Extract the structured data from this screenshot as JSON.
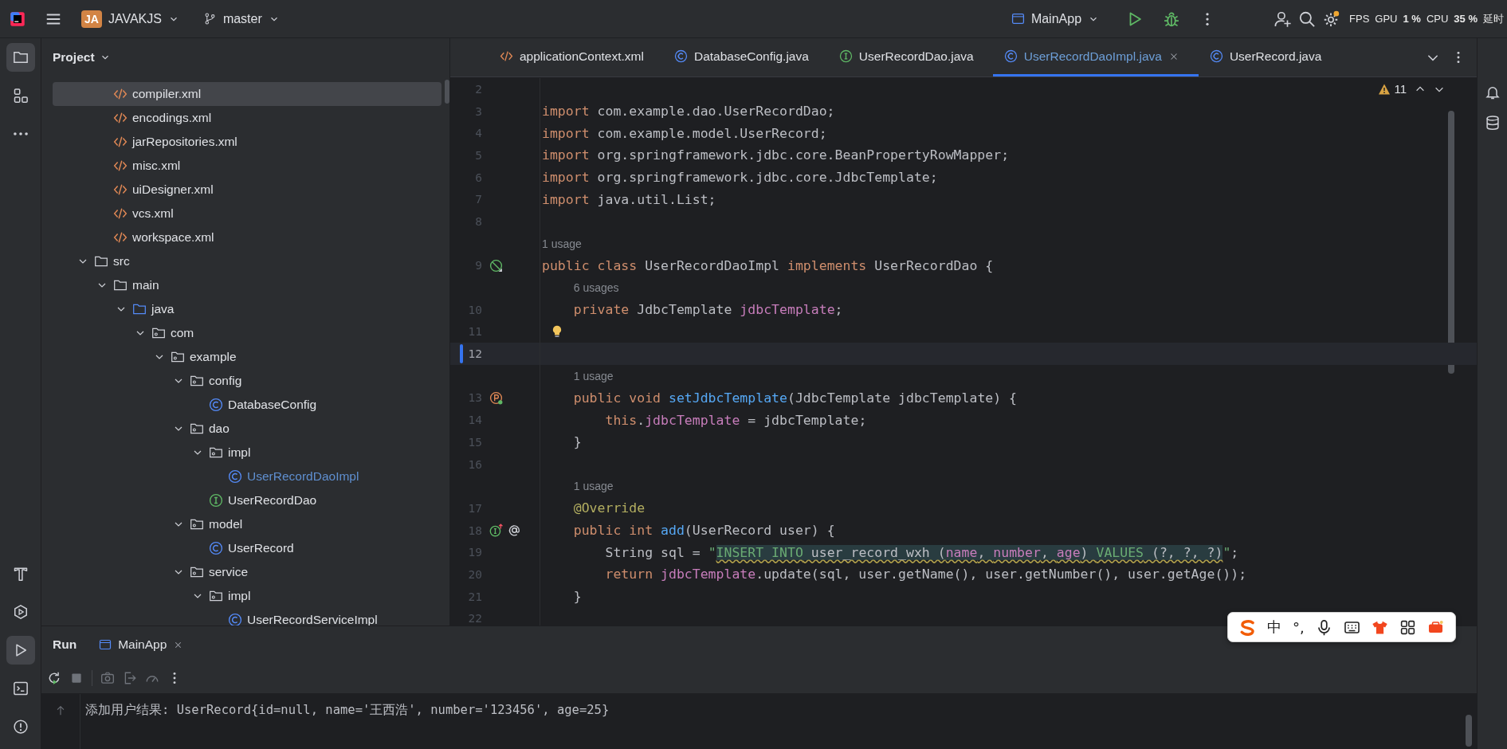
{
  "title_bar": {
    "project_badge": "JA",
    "project_name": "JAVAKJS",
    "branch": "master",
    "run_config": "MainApp",
    "system_overlay": [
      "FPS",
      "GPU",
      "1 %",
      "CPU",
      "35 %",
      "延时"
    ]
  },
  "tool_strip": {
    "top": [
      {
        "kind": "project",
        "selected": true
      },
      {
        "kind": "structure",
        "selected": false
      },
      {
        "kind": "more",
        "selected": false
      }
    ],
    "bottom": [
      {
        "kind": "build",
        "selected": false
      },
      {
        "kind": "services",
        "selected": false
      },
      {
        "kind": "run",
        "selected": true
      },
      {
        "kind": "terminal",
        "selected": false
      },
      {
        "kind": "problems",
        "selected": false
      }
    ]
  },
  "project_panel": {
    "title": "Project",
    "scrolled_children": [
      {
        "label": "compiler.xml",
        "kind": "xml",
        "selected": true,
        "current": false
      },
      {
        "label": "encodings.xml",
        "kind": "xml",
        "selected": false,
        "current": false
      },
      {
        "label": "jarRepositories.xml",
        "kind": "xml",
        "selected": false,
        "current": false
      },
      {
        "label": "misc.xml",
        "kind": "xml",
        "selected": false,
        "current": false
      },
      {
        "label": "uiDesigner.xml",
        "kind": "xml",
        "selected": false,
        "current": false
      },
      {
        "label": "vcs.xml",
        "kind": "xml",
        "selected": false,
        "current": false
      },
      {
        "label": "workspace.xml",
        "kind": "xml",
        "selected": false,
        "current": false
      }
    ],
    "tree": [
      {
        "label": "src",
        "kind": "folder",
        "expanded": true,
        "selected": false,
        "current": false,
        "children": [
          {
            "label": "main",
            "kind": "folder",
            "expanded": true,
            "selected": false,
            "current": false,
            "children": [
              {
                "label": "java",
                "kind": "source",
                "expanded": true,
                "selected": false,
                "current": false,
                "children": [
                  {
                    "label": "com",
                    "kind": "package",
                    "expanded": true,
                    "selected": false,
                    "current": false,
                    "children": [
                      {
                        "label": "example",
                        "kind": "package",
                        "expanded": true,
                        "selected": false,
                        "current": false,
                        "children": [
                          {
                            "label": "config",
                            "kind": "package",
                            "expanded": true,
                            "selected": false,
                            "current": false,
                            "children": [
                              {
                                "label": "DatabaseConfig",
                                "kind": "class",
                                "selected": false,
                                "current": false
                              }
                            ]
                          },
                          {
                            "label": "dao",
                            "kind": "package",
                            "expanded": true,
                            "selected": false,
                            "current": false,
                            "children": [
                              {
                                "label": "impl",
                                "kind": "package",
                                "expanded": true,
                                "selected": false,
                                "current": false,
                                "children": [
                                  {
                                    "label": "UserRecordDaoImpl",
                                    "kind": "class",
                                    "selected": false,
                                    "current": true
                                  }
                                ]
                              },
                              {
                                "label": "UserRecordDao",
                                "kind": "interface",
                                "selected": false,
                                "current": false
                              }
                            ]
                          },
                          {
                            "label": "model",
                            "kind": "package",
                            "expanded": true,
                            "selected": false,
                            "current": false,
                            "children": [
                              {
                                "label": "UserRecord",
                                "kind": "class",
                                "selected": false,
                                "current": false
                              }
                            ]
                          },
                          {
                            "label": "service",
                            "kind": "package",
                            "expanded": true,
                            "selected": false,
                            "current": false,
                            "children": [
                              {
                                "label": "impl",
                                "kind": "package",
                                "expanded": true,
                                "selected": false,
                                "current": false,
                                "children": [
                                  {
                                    "label": "UserRecordServiceImpl",
                                    "kind": "class",
                                    "selected": false,
                                    "current": false
                                  }
                                ]
                              }
                            ]
                          }
                        ]
                      }
                    ]
                  }
                ]
              }
            ]
          }
        ]
      }
    ]
  },
  "editor": {
    "tabs": [
      {
        "label": "applicationContext.xml",
        "kind": "xml",
        "selected": false
      },
      {
        "label": "DatabaseConfig.java",
        "kind": "class",
        "selected": false
      },
      {
        "label": "UserRecordDao.java",
        "kind": "interface",
        "selected": false
      },
      {
        "label": "UserRecordDaoImpl.java",
        "kind": "class",
        "selected": true
      },
      {
        "label": "UserRecord.java",
        "kind": "class",
        "selected": false
      }
    ],
    "warning_count": "11",
    "lines": [
      {
        "kind": "code",
        "number": "2",
        "current": false
      },
      {
        "kind": "code",
        "number": "3",
        "current": false,
        "tokens": [
          {
            "kind": "keyword",
            "text": "import"
          },
          {
            "kind": "plain",
            "text": " com.example.dao.UserRecordDao;"
          }
        ]
      },
      {
        "kind": "code",
        "number": "4",
        "current": false,
        "tokens": [
          {
            "kind": "keyword",
            "text": "import"
          },
          {
            "kind": "plain",
            "text": " com.example.model.UserRecord;"
          }
        ]
      },
      {
        "kind": "code",
        "number": "5",
        "current": false,
        "tokens": [
          {
            "kind": "keyword",
            "text": "import"
          },
          {
            "kind": "plain",
            "text": " org.springframework.jdbc.core.BeanPropertyRowMapper;"
          }
        ]
      },
      {
        "kind": "code",
        "number": "6",
        "current": false,
        "tokens": [
          {
            "kind": "keyword",
            "text": "import"
          },
          {
            "kind": "plain",
            "text": " org.springframework.jdbc.core.JdbcTemplate;"
          }
        ]
      },
      {
        "kind": "code",
        "number": "7",
        "current": false,
        "tokens": [
          {
            "kind": "keyword",
            "text": "import"
          },
          {
            "kind": "plain",
            "text": " java.util.List;"
          }
        ]
      },
      {
        "kind": "code",
        "number": "8",
        "current": false
      },
      {
        "kind": "hint",
        "text": "1 usage"
      },
      {
        "kind": "code",
        "number": "9",
        "current": false,
        "gutter": [
          {
            "kind": "implemented"
          }
        ],
        "tokens": [
          {
            "kind": "keyword",
            "text": "public class"
          },
          {
            "kind": "plain",
            "text": " UserRecordDaoImpl "
          },
          {
            "kind": "keyword",
            "text": "implements"
          },
          {
            "kind": "plain",
            "text": " UserRecordDao {"
          }
        ]
      },
      {
        "kind": "hint",
        "text": "6 usages"
      },
      {
        "kind": "code",
        "number": "10",
        "current": false,
        "tokens": [
          {
            "kind": "keyword",
            "text": "    private"
          },
          {
            "kind": "plain",
            "text": " JdbcTemplate "
          },
          {
            "kind": "field",
            "text": "jdbcTemplate"
          },
          {
            "kind": "plain",
            "text": ";"
          }
        ]
      },
      {
        "kind": "code",
        "number": "11",
        "current": false,
        "bulb": true
      },
      {
        "kind": "code",
        "number": "12",
        "current": true
      },
      {
        "kind": "hint",
        "text": "1 usage"
      },
      {
        "kind": "code",
        "number": "13",
        "current": false,
        "gutter": [
          {
            "kind": "property"
          }
        ],
        "tokens": [
          {
            "kind": "keyword",
            "text": "    public void "
          },
          {
            "kind": "method",
            "text": "setJdbcTemplate"
          },
          {
            "kind": "plain",
            "text": "(JdbcTemplate jdbcTemplate) {"
          }
        ]
      },
      {
        "kind": "code",
        "number": "14",
        "current": false,
        "tokens": [
          {
            "kind": "keyword",
            "text": "        this"
          },
          {
            "kind": "plain",
            "text": "."
          },
          {
            "kind": "field",
            "text": "jdbcTemplate"
          },
          {
            "kind": "plain",
            "text": " = jdbcTemplate;"
          }
        ]
      },
      {
        "kind": "code",
        "number": "15",
        "current": false,
        "tokens": [
          {
            "kind": "plain",
            "text": "    }"
          }
        ]
      },
      {
        "kind": "code",
        "number": "16",
        "current": false
      },
      {
        "kind": "hint",
        "text": "1 usage"
      },
      {
        "kind": "code",
        "number": "17",
        "current": false,
        "tokens": [
          {
            "kind": "annotation",
            "text": "    @Override"
          }
        ]
      },
      {
        "kind": "code",
        "number": "18",
        "current": false,
        "gutter": [
          {
            "kind": "implements"
          },
          {
            "kind": "annotation"
          }
        ],
        "tokens": [
          {
            "kind": "keyword",
            "text": "    public int "
          },
          {
            "kind": "method",
            "text": "add"
          },
          {
            "kind": "plain",
            "text": "(UserRecord user) {"
          }
        ]
      },
      {
        "kind": "code",
        "number": "19",
        "current": false,
        "tokens": [
          {
            "kind": "plain",
            "text": "        String sql = "
          },
          {
            "kind": "string",
            "text": "\""
          },
          {
            "kind": "sql-keyword",
            "text": "INSERT INTO"
          },
          {
            "kind": "sql",
            "text": " user_record_wxh ("
          },
          {
            "kind": "sql-column",
            "text": "name"
          },
          {
            "kind": "sql",
            "text": ", "
          },
          {
            "kind": "sql-column",
            "text": "number"
          },
          {
            "kind": "sql",
            "text": ", "
          },
          {
            "kind": "sql-column",
            "text": "age"
          },
          {
            "kind": "sql",
            "text": ") "
          },
          {
            "kind": "sql-keyword",
            "text": "VALUES"
          },
          {
            "kind": "sql",
            "text": " (?, ?, ?)"
          },
          {
            "kind": "string",
            "text": "\""
          },
          {
            "kind": "plain",
            "text": ";"
          }
        ]
      },
      {
        "kind": "code",
        "number": "20",
        "current": false,
        "tokens": [
          {
            "kind": "keyword",
            "text": "        return "
          },
          {
            "kind": "field",
            "text": "jdbcTemplate"
          },
          {
            "kind": "plain",
            "text": ".update(sql, user.getName(), user.getNumber(), user.getAge());"
          }
        ]
      },
      {
        "kind": "code",
        "number": "21",
        "current": false,
        "tokens": [
          {
            "kind": "plain",
            "text": "    }"
          }
        ]
      },
      {
        "kind": "code",
        "number": "22",
        "current": false
      }
    ]
  },
  "run_panel": {
    "title": "Run",
    "tabs": [
      {
        "label": "MainApp"
      }
    ],
    "output": [
      "添加用户结果: UserRecord{id=null, name='王西浩', number='123456', age=25}"
    ]
  },
  "ime_toolbar": {
    "items": [
      {
        "kind": "logo"
      },
      {
        "kind": "text",
        "text": "中"
      },
      {
        "kind": "text",
        "text": "°,"
      },
      {
        "kind": "microphone"
      },
      {
        "kind": "keyboard"
      },
      {
        "kind": "shirt"
      },
      {
        "kind": "grid"
      },
      {
        "kind": "toolbox"
      }
    ]
  }
}
